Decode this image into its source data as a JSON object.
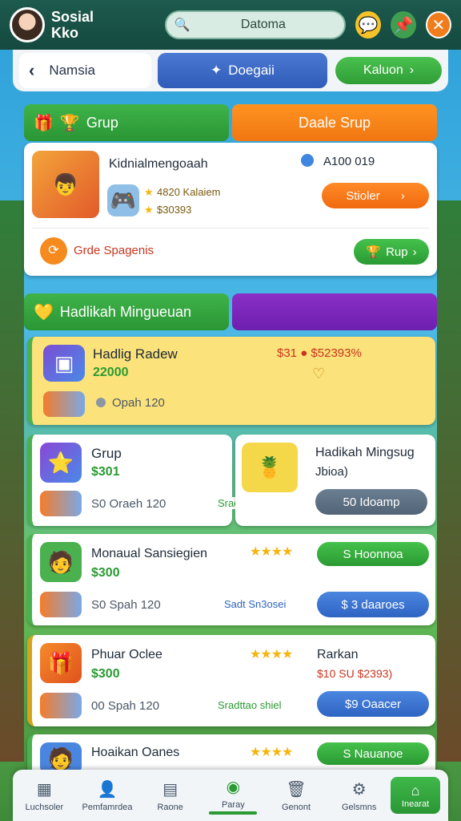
{
  "app": {
    "title_line1": "Sosial",
    "title_line2": "Kko"
  },
  "header": {
    "search_value": "Datoma"
  },
  "tabs": {
    "back_label": "Namsia",
    "middle_label": "Doegaii",
    "right_label": "Kaluon"
  },
  "section1": {
    "group_label": "Grup",
    "right_label": "Daale Srup"
  },
  "featured": {
    "title": "Kidnialmengoaah",
    "info": "A100 019",
    "rating1": "4820 Kalaiem",
    "rating2": "$30393",
    "action": "Stioler",
    "footer_label": "Grde Spagenis",
    "footer_button": "Rup"
  },
  "section2": {
    "label": "Hadlikah Mingueuan"
  },
  "highlight": {
    "title": "Hadlig Radew",
    "value": "22000",
    "price": "$31 ● $52393%",
    "meta": "Opah 120"
  },
  "row_a_left": {
    "title": "Grup",
    "price": "$301",
    "meta": "S0 Oraeh 120",
    "link": "Sradttac soon"
  },
  "row_a_right": {
    "title": "Hadikah Mingsug",
    "subtitle": "Jbioa)",
    "button": "50 Idoamp"
  },
  "row_b": {
    "title": "Monaual Sansiegien",
    "price": "$300",
    "meta": "S0 Spah 120",
    "link": "Sadt Sn3osei",
    "btn1": "S Hoonnoa",
    "btn2": "$ 3 daaroes"
  },
  "row_c": {
    "title": "Phuar Oclee",
    "price": "$300",
    "meta": "00 Spah 120",
    "link": "Sradttao shiel",
    "side_title": "Rarkan",
    "side_price": "$10 SU $2393)",
    "btn": "$9 Oaacer"
  },
  "row_d": {
    "title": "Hoaikan Oanes",
    "btn": "S Nauanoe"
  },
  "nav": {
    "items": [
      "Luchsoler",
      "Pemfamrdea",
      "Raone",
      "Paray",
      "Genont",
      "Gelsmns"
    ],
    "last": "Inearat"
  }
}
